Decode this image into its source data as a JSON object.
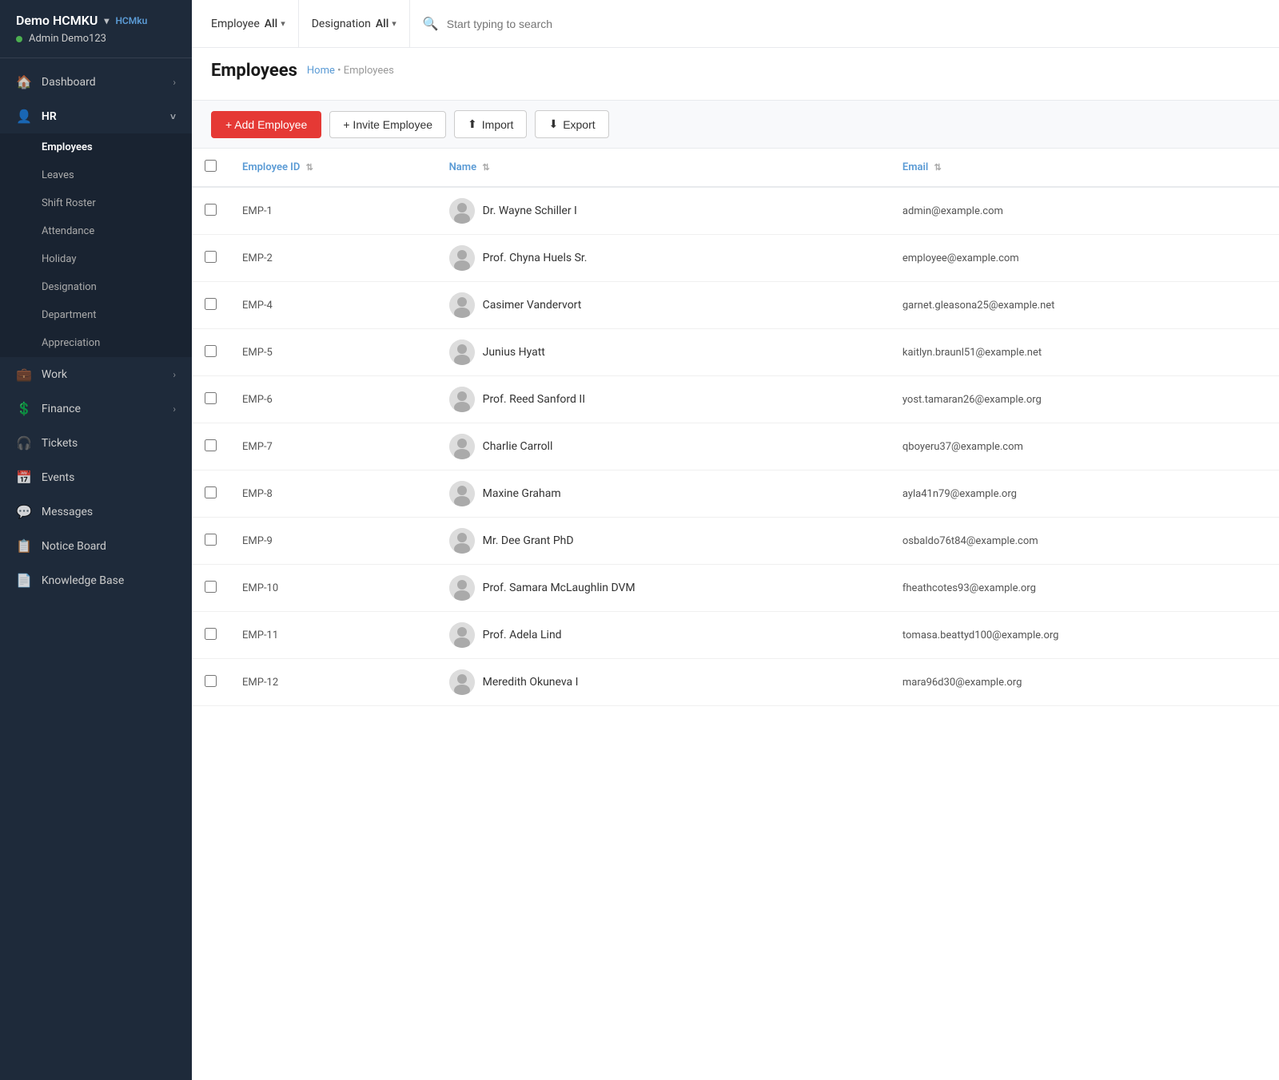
{
  "brand": {
    "name": "Demo HCMKU",
    "link_label": "HCMku",
    "user": "Admin Demo123"
  },
  "sidebar": {
    "items": [
      {
        "id": "dashboard",
        "label": "Dashboard",
        "icon": "🏠",
        "has_arrow": true,
        "expanded": false
      },
      {
        "id": "hr",
        "label": "HR",
        "icon": "👤",
        "has_arrow": true,
        "expanded": true
      },
      {
        "id": "work",
        "label": "Work",
        "icon": "💼",
        "has_arrow": true,
        "expanded": false
      },
      {
        "id": "finance",
        "label": "Finance",
        "icon": "💲",
        "has_arrow": true,
        "expanded": false
      },
      {
        "id": "tickets",
        "label": "Tickets",
        "icon": "🎧",
        "has_arrow": false,
        "expanded": false
      },
      {
        "id": "events",
        "label": "Events",
        "icon": "📅",
        "has_arrow": false,
        "expanded": false
      },
      {
        "id": "messages",
        "label": "Messages",
        "icon": "💬",
        "has_arrow": false,
        "expanded": false
      },
      {
        "id": "notice-board",
        "label": "Notice Board",
        "icon": "📋",
        "has_arrow": false,
        "expanded": false
      },
      {
        "id": "knowledge-base",
        "label": "Knowledge Base",
        "icon": "📄",
        "has_arrow": false,
        "expanded": false
      }
    ],
    "hr_subitems": [
      {
        "id": "employees",
        "label": "Employees",
        "active": true
      },
      {
        "id": "leaves",
        "label": "Leaves",
        "active": false
      },
      {
        "id": "shift-roster",
        "label": "Shift Roster",
        "active": false
      },
      {
        "id": "attendance",
        "label": "Attendance",
        "active": false
      },
      {
        "id": "holiday",
        "label": "Holiday",
        "active": false
      },
      {
        "id": "designation",
        "label": "Designation",
        "active": false
      },
      {
        "id": "department",
        "label": "Department",
        "active": false
      },
      {
        "id": "appreciation",
        "label": "Appreciation",
        "active": false
      }
    ]
  },
  "filter_bar": {
    "employee_label": "Employee",
    "employee_value": "All",
    "designation_label": "Designation",
    "designation_value": "All",
    "search_placeholder": "Start typing to search"
  },
  "page": {
    "title": "Employees",
    "breadcrumb_home": "Home",
    "breadcrumb_separator": "•",
    "breadcrumb_current": "Employees"
  },
  "actions": {
    "add_label": "+ Add Employee",
    "invite_label": "+ Invite Employee",
    "import_label": "Import",
    "export_label": "Export"
  },
  "table": {
    "columns": [
      {
        "id": "emp-id",
        "label": "Employee ID",
        "sortable": true
      },
      {
        "id": "name",
        "label": "Name",
        "sortable": true
      },
      {
        "id": "email",
        "label": "Email",
        "sortable": true
      }
    ],
    "rows": [
      {
        "id": "EMP-1",
        "name": "Dr. Wayne Schiller I",
        "email": "admin@example.com"
      },
      {
        "id": "EMP-2",
        "name": "Prof. Chyna Huels Sr.",
        "email": "employee@example.com"
      },
      {
        "id": "EMP-4",
        "name": "Casimer Vandervort",
        "email": "garnet.gleasona25@example.net"
      },
      {
        "id": "EMP-5",
        "name": "Junius Hyatt",
        "email": "kaitlyn.braunl51@example.net"
      },
      {
        "id": "EMP-6",
        "name": "Prof. Reed Sanford II",
        "email": "yost.tamaran26@example.org"
      },
      {
        "id": "EMP-7",
        "name": "Charlie Carroll",
        "email": "qboyeru37@example.com"
      },
      {
        "id": "EMP-8",
        "name": "Maxine Graham",
        "email": "ayla41n79@example.org"
      },
      {
        "id": "EMP-9",
        "name": "Mr. Dee Grant PhD",
        "email": "osbaldo76t84@example.com"
      },
      {
        "id": "EMP-10",
        "name": "Prof. Samara McLaughlin DVM",
        "email": "fheathcotes93@example.org"
      },
      {
        "id": "EMP-11",
        "name": "Prof. Adela Lind",
        "email": "tomasa.beattyd100@example.org"
      },
      {
        "id": "EMP-12",
        "name": "Meredith Okuneva I",
        "email": "mara96d30@example.org"
      }
    ]
  }
}
